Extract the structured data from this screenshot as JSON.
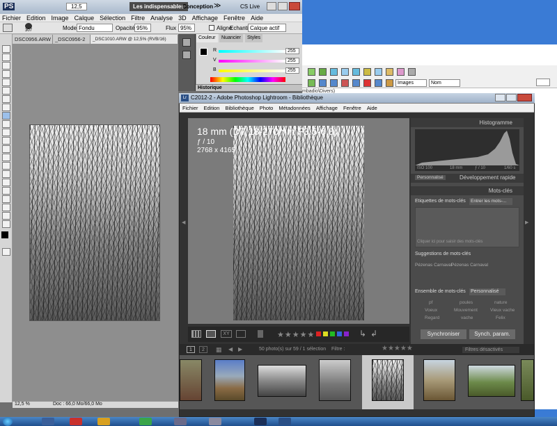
{
  "photoshop": {
    "logo": "PS",
    "zoom": "12,5",
    "workspace_active": "Les indispensables",
    "workspace_alt": "Conception",
    "more": "≫",
    "cslive": "CS Live",
    "menu": [
      "Fichier",
      "Edition",
      "Image",
      "Calque",
      "Sélection",
      "Filtre",
      "Analyse",
      "3D",
      "Affichage",
      "Fenêtre",
      "Aide"
    ],
    "options": {
      "brush_size": "307",
      "mode_label": "Mode :",
      "mode_value": "Fondu",
      "opacity_label": "Opacité :",
      "opacity_value": "95%",
      "flow_label": "Flux :",
      "flow_value": "95%",
      "aligned_label": "Aligné",
      "sample_label": "Echantil. :",
      "sample_value": "Calque actif"
    },
    "tabs": [
      "DSC0956.ARW",
      "_DSC0956-2",
      "_DSC1010.ARW @ 12,5% (RVB/16)"
    ],
    "status": {
      "zoom": "12,5 %",
      "doc": "Doc : 66,0 Mo/66,0 Mo"
    },
    "panel": {
      "tabs": [
        "Couleur",
        "Nuancier",
        "Styles"
      ],
      "channels": [
        {
          "label": "R",
          "value": "255",
          "color": "#00c0c0"
        },
        {
          "label": "V",
          "value": "255",
          "color": "#e000e0"
        },
        {
          "label": "B",
          "value": "255",
          "color": "#e0d000"
        }
      ],
      "history_label": "Historique"
    }
  },
  "explorer": {
    "view_label": "Images",
    "sort_label": "Nom",
    "path": "mbadio\\Divers)"
  },
  "lightroom": {
    "title": "C2012-2 - Adobe Photoshop Lightroom - Bibliothèque",
    "menu": [
      "Fichier",
      "Edition",
      "Bibliothèque",
      "Photo",
      "Métadonnées",
      "Affichage",
      "Fenêtre",
      "Aide"
    ],
    "info_line1": "18 mm (DT 18-270mm F3.5-6.3)",
    "info_line2": "ƒ / 10",
    "info_line3": "2768 x 4165",
    "stars": "★★★★★",
    "histogram": {
      "label": "Histogramme",
      "iso": "ISO 100",
      "focal": "18 mm",
      "aperture": "ƒ / 10",
      "shutter": "1/60 s"
    },
    "quick_dev": {
      "preset": "Personnalisé",
      "label": "Développement rapide"
    },
    "keywords": {
      "label": "Mots-clés",
      "tags_label": "Etiquettes de mots-clés",
      "tags_select": "Entrer les mots-...",
      "placeholder": "Cliquer ici pour saisir des mots-clés",
      "suggest_label": "Suggestions de mots-clés",
      "suggestions": [
        "Pézenas Carnaval",
        "Pézenas Carnaval"
      ],
      "set_label": "Ensemble de mots-clés",
      "set_value": "Personnalisé",
      "set_words": [
        "pf",
        "poules",
        "nature",
        "Voeux",
        "Mouvement",
        "Vieux vache",
        "Regard",
        "vache",
        "Felix"
      ]
    },
    "sync_button": "Synchroniser",
    "sync_params_button": "Synch. param.",
    "filmstrip": {
      "page1": "1",
      "page2": "2",
      "count": "50 photo(s) sur 59 / 1 sélection",
      "filter_label": "Filtre :",
      "filter_status": "Filtres désactivés"
    }
  }
}
